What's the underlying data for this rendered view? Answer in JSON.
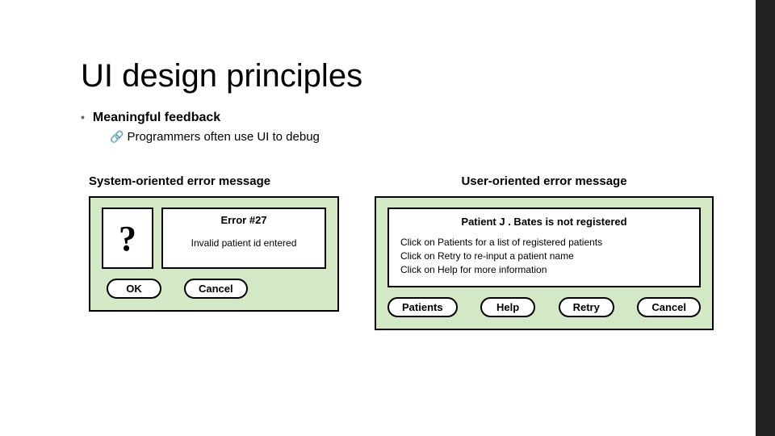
{
  "title": "UI design principles",
  "bullet": {
    "text": "Meaningful feedback"
  },
  "sub": {
    "text": "Programmers often use UI to debug"
  },
  "figA": {
    "heading": "System-oriented error message",
    "icon_glyph": "?",
    "error_title": "Error #27",
    "error_body": "Invalid patient id entered",
    "ok": "OK",
    "cancel": "Cancel"
  },
  "figB": {
    "heading": "User-oriented error message",
    "msg_title": "Patient J . Bates is not registered",
    "line1": "Click on Patients for a list of registered patients",
    "line2": "Click on Retry to re-input a patient name",
    "line3": "Click on Help for more information",
    "btn_patients": "Patients",
    "btn_help": "Help",
    "btn_retry": "Retry",
    "btn_cancel": "Cancel"
  }
}
